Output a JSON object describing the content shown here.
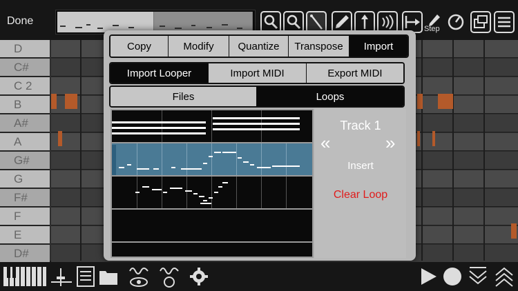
{
  "topbar": {
    "done_label": "Done",
    "step_label": "Step"
  },
  "tools": [
    "search-icon",
    "search-zoom-icon",
    "magic-wand-icon",
    "pencil-icon",
    "arrow-up-icon",
    "speaker-icon",
    "arrow-right-bar-icon",
    "step-pencil-icon",
    "knob-icon",
    "window-icon",
    "menu-icon"
  ],
  "piano_keys": [
    {
      "label": "D",
      "color": "white"
    },
    {
      "label": "C#",
      "color": "black"
    },
    {
      "label": "C  2",
      "color": "white"
    },
    {
      "label": "B",
      "color": "white"
    },
    {
      "label": "A#",
      "color": "black"
    },
    {
      "label": "A",
      "color": "white"
    },
    {
      "label": "G#",
      "color": "black"
    },
    {
      "label": "G",
      "color": "white"
    },
    {
      "label": "F#",
      "color": "black"
    },
    {
      "label": "F",
      "color": "white"
    },
    {
      "label": "E",
      "color": "white"
    },
    {
      "label": "D#",
      "color": "black"
    }
  ],
  "modal": {
    "top_tabs": [
      {
        "label": "Copy",
        "active": false
      },
      {
        "label": "Modify",
        "active": false
      },
      {
        "label": "Quantize",
        "active": false
      },
      {
        "label": "Transpose",
        "active": false
      },
      {
        "label": "Import",
        "active": true
      }
    ],
    "import_tabs": [
      {
        "label": "Import Looper",
        "active": true
      },
      {
        "label": "Import MIDI",
        "active": false
      },
      {
        "label": "Export MIDI",
        "active": false
      }
    ],
    "source_tabs": [
      {
        "label": "Files",
        "active": false
      },
      {
        "label": "Loops",
        "active": true
      }
    ],
    "side": {
      "track_title": "Track 1",
      "prev_icon": "«",
      "next_icon": "»",
      "insert_label": "Insert",
      "clear_label": "Clear Loop"
    }
  },
  "colors": {
    "note": "#b45a2a",
    "selected_loop": "#4a7a95",
    "clear_loop": "#e01b1b"
  }
}
